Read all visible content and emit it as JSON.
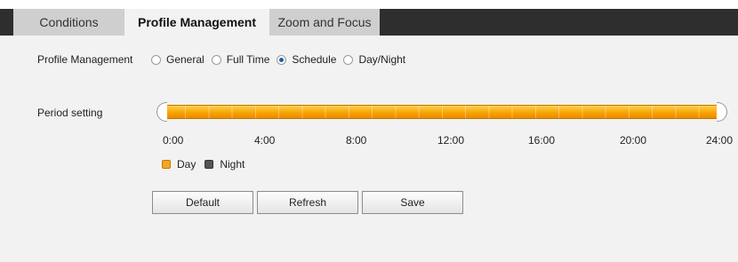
{
  "tabs": [
    {
      "label": "Conditions"
    },
    {
      "label": "Profile Management"
    },
    {
      "label": "Zoom and Focus"
    }
  ],
  "profile": {
    "label": "Profile Management",
    "options": [
      "General",
      "Full Time",
      "Schedule",
      "Day/Night"
    ],
    "selected": "Schedule"
  },
  "period": {
    "label": "Period setting",
    "ticks": [
      "0:00",
      "4:00",
      "8:00",
      "12:00",
      "16:00",
      "20:00",
      "24:00"
    ],
    "day_range": [
      "0:00",
      "24:00"
    ],
    "legend": {
      "day": "Day",
      "night": "Night"
    }
  },
  "buttons": {
    "default": "Default",
    "refresh": "Refresh",
    "save": "Save"
  },
  "colors": {
    "day": "#f5a623",
    "night": "#555555",
    "tab_active_bg": "#f2f2f2",
    "tabstrip": "#2e2e2e"
  }
}
